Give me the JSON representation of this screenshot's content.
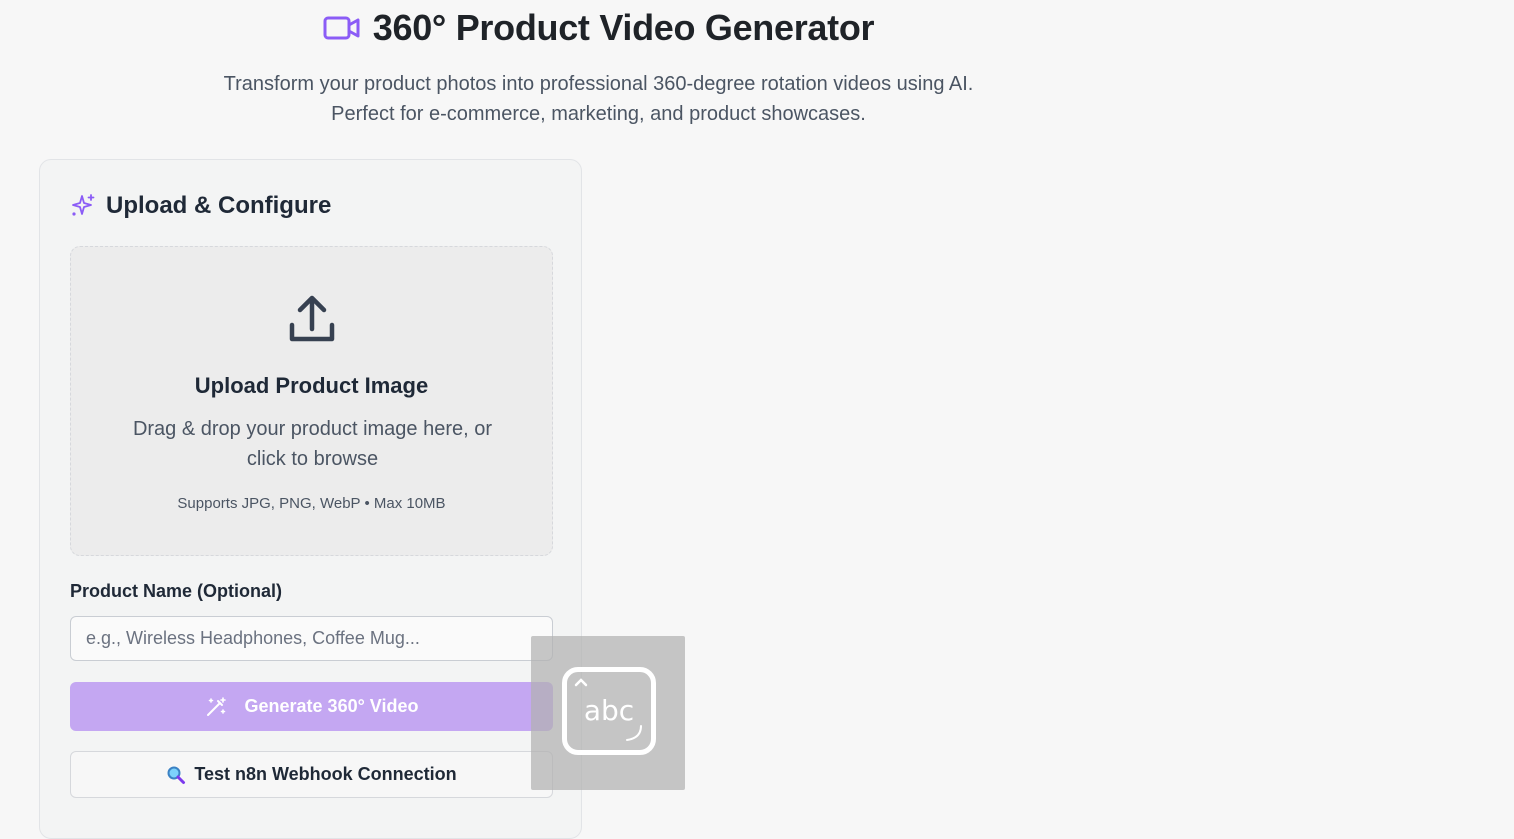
{
  "header": {
    "icon": "video-camera-icon",
    "title": "360° Product Video Generator",
    "subtitle_line1": "Transform your product photos into professional 360-degree rotation videos using AI.",
    "subtitle_line2": "Perfect for e-commerce, marketing, and product showcases."
  },
  "card": {
    "icon": "sparkles-icon",
    "title": "Upload & Configure",
    "dropzone": {
      "icon": "upload-icon",
      "title": "Upload Product Image",
      "text": "Drag & drop your product image here, or click to browse",
      "note": "Supports JPG, PNG, WebP • Max 10MB"
    },
    "product_name": {
      "label": "Product Name (Optional)",
      "placeholder": "e.g., Wireless Headphones, Coffee Mug...",
      "value": ""
    },
    "generate_button": {
      "icon": "magic-wand-icon",
      "label": "Generate 360° Video"
    },
    "test_button": {
      "icon": "magnifying-glass-icon",
      "label": "Test n8n Webhook Connection"
    }
  },
  "overlay": {
    "icon": "text-input-indicator-icon",
    "text": "abc"
  },
  "colors": {
    "accent": "#8b5cf6",
    "generate_disabled": "#c4a7f2",
    "background": "#f7f7f7"
  }
}
